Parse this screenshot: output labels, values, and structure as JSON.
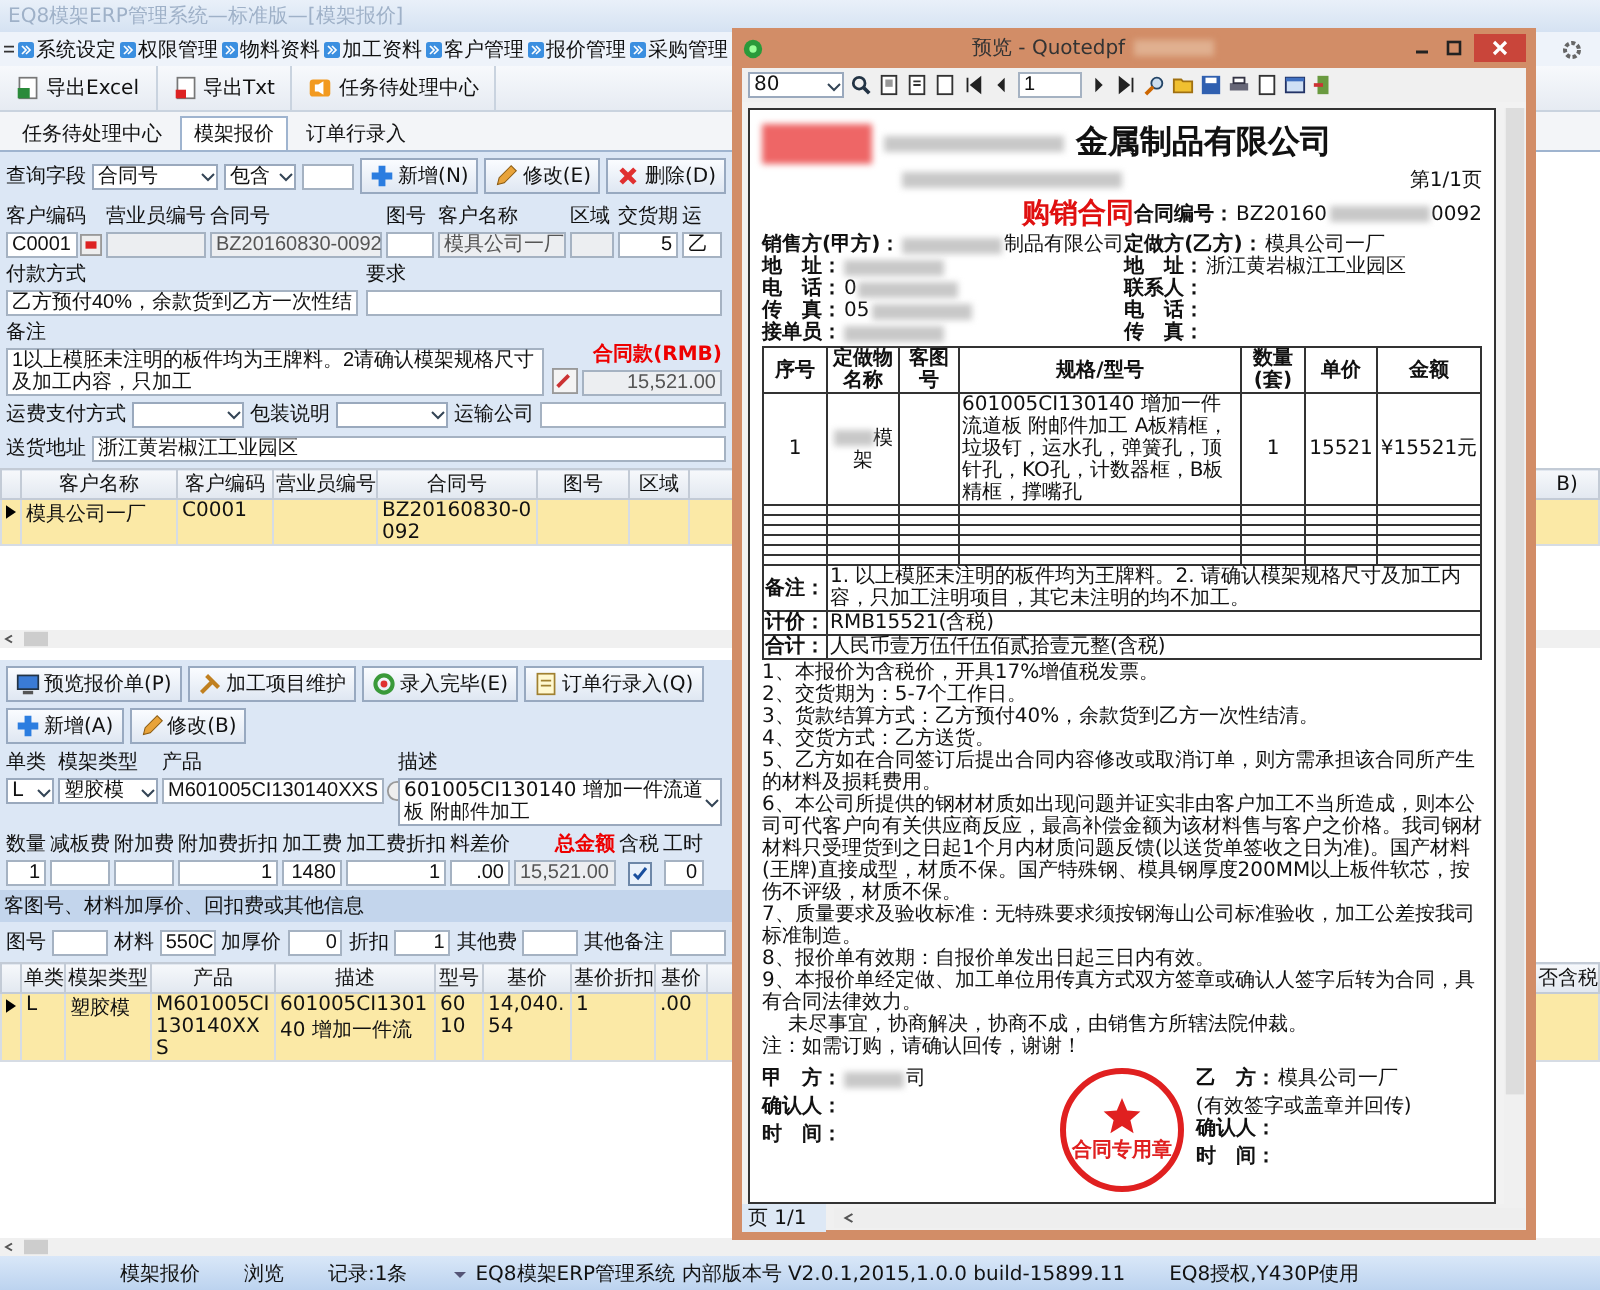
{
  "window": {
    "title": "EQ8模架ERP管理系统—标准版—[模架报价]"
  },
  "menu": [
    "系统设定",
    "权限管理",
    "物料资料",
    "加工资料",
    "客户管理",
    "报价管理",
    "采购管理"
  ],
  "toolbar": [
    {
      "label": "导出Excel",
      "kind": "excel"
    },
    {
      "label": "导出Txt",
      "kind": "txt"
    },
    {
      "label": "任务待处理中心",
      "kind": "speaker"
    }
  ],
  "tabs": [
    {
      "label": "任务待处理中心",
      "selected": false
    },
    {
      "label": "模架报价",
      "selected": true
    },
    {
      "label": "订单行录入",
      "selected": false
    }
  ],
  "query": {
    "label": "查询字段",
    "field": "合同号",
    "operator": "包含",
    "buttons": [
      {
        "label": "新增(N)",
        "kind": "add"
      },
      {
        "label": "修改(E)",
        "kind": "edit"
      },
      {
        "label": "删除(D)",
        "kind": "delete"
      }
    ]
  },
  "header_fields": [
    {
      "label": "客户编码",
      "value": "C0001",
      "kind": "lookup",
      "disabled": false
    },
    {
      "label": "营业员编号",
      "kind": "text",
      "disabled": true
    },
    {
      "label": "合同号",
      "value": "BZ20160830-0092",
      "kind": "text",
      "disabled": true
    },
    {
      "label": "图号",
      "kind": "text",
      "disabled": false
    },
    {
      "label": "客户名称",
      "value": "模具公司一厂",
      "kind": "text",
      "disabled": true
    },
    {
      "label": "区域",
      "kind": "text",
      "disabled": true
    },
    {
      "label": "交货期",
      "value": "5",
      "kind": "number",
      "disabled": false
    },
    {
      "label": "运",
      "value": "乙",
      "kind": "text",
      "disabled": false
    }
  ],
  "payment": {
    "label": "付款方式",
    "value": "乙方预付40%，余款货到乙方一次性结"
  },
  "requirement": {
    "label": "要求"
  },
  "remarks": {
    "label": "备注",
    "value": "1以上模胚未注明的板件均为王牌料。2请确认模架规格尺寸及加工内容，只加工"
  },
  "contract_amount": {
    "label": "合同款(RMB)",
    "value": "15,521.00"
  },
  "shipping": [
    {
      "label": "运费支付方式",
      "kind": "select"
    },
    {
      "label": "包装说明",
      "kind": "select"
    },
    {
      "label": "运输公司",
      "kind": "text"
    }
  ],
  "address": {
    "label": "送货地址",
    "value": "浙江黄岩椒江工业园区"
  },
  "contract_table": {
    "columns": [
      "客户名称",
      "客户编码",
      "营业员编号",
      "合同号",
      "图号",
      "区域",
      "B)"
    ],
    "rows": [
      {
        "selected": true,
        "cells": [
          "模具公司一厂",
          "C0001",
          "",
          "BZ20160830-0092",
          "",
          "",
          ""
        ]
      }
    ]
  },
  "line_buttons": [
    {
      "label": "预览报价单(P)",
      "kind": "preview"
    },
    {
      "label": "加工项目维护",
      "kind": "tools"
    },
    {
      "label": "录入完毕(E)",
      "kind": "done"
    },
    {
      "label": "订单行录入(Q)",
      "kind": "order"
    },
    {
      "label": "新增(A)",
      "kind": "add"
    },
    {
      "label": "修改(B)",
      "kind": "edit"
    }
  ],
  "line_fields": [
    {
      "label": "单类",
      "value": "L",
      "kind": "select"
    },
    {
      "label": "模架类型",
      "value": "塑胶模",
      "kind": "select"
    },
    {
      "label": "产品",
      "value": "M601005CI130140XXS",
      "kind": "lookup"
    },
    {
      "label": "描述",
      "value": "601005CI130140 增加一件流道板 附邮件加工",
      "kind": "select"
    }
  ],
  "amount_fields": [
    {
      "label": "数量",
      "value": "1",
      "kind": "number"
    },
    {
      "label": "减板费",
      "kind": "number"
    },
    {
      "label": "附加费",
      "kind": "number"
    },
    {
      "label": "附加费折扣",
      "value": "1",
      "kind": "number"
    },
    {
      "label": "加工费",
      "value": "1480",
      "kind": "number"
    },
    {
      "label": "加工费折扣",
      "value": "1",
      "kind": "number"
    },
    {
      "label": "料差价",
      "value": ".00",
      "kind": "number"
    },
    {
      "label": "总金额",
      "value": "15,521.00",
      "kind": "total"
    },
    {
      "label": "含税",
      "kind": "checkbox",
      "checked": true
    },
    {
      "label": "工时",
      "value": "0",
      "kind": "number"
    }
  ],
  "extra_section": {
    "title": "客图号、材料加厚价、回扣费或其他信息",
    "fields": [
      {
        "label": "图号"
      },
      {
        "label": "材料",
        "value": "550C"
      },
      {
        "label": "加厚价",
        "value": "0"
      },
      {
        "label": "折扣",
        "value": "1"
      },
      {
        "label": "其他费"
      },
      {
        "label": "其他备注"
      }
    ]
  },
  "line_table": {
    "columns": [
      "单类",
      "模架类型",
      "产品",
      "描述",
      "型号",
      "基价",
      "基价折扣",
      "基价",
      "否含税"
    ],
    "rows": [
      {
        "selected": true,
        "cells": [
          "L",
          "塑胶模",
          "M601005CI130140XXS",
          "601005CI130140 增加一件流",
          "6010",
          "14,040.54",
          "1",
          ".00",
          ""
        ]
      }
    ]
  },
  "status_bar": [
    "模架报价",
    "浏览",
    "记录:1条",
    "EQ8模架ERP管理系统 内部版本号 V2.0.1,2015,1.0.0 build-15899.11",
    "EQ8授权,Y430P使用"
  ],
  "preview": {
    "title": "预览 - Quotedpf",
    "zoom": "80",
    "page": "1",
    "page_status": "页 1/1",
    "document": {
      "company": "金属制品有限公司",
      "page_no": "第1/1页",
      "title": "购销合同",
      "contract_no": {
        "label": "合同编号：",
        "value": "BZ20160",
        "blurred": true,
        "suffix": "0092"
      },
      "seller": [
        {
          "label": "销售方(甲方)：",
          "blurred": true,
          "suffix": "制品有限公司"
        },
        {
          "label": "地　址：",
          "blurred": true
        },
        {
          "label": "电　话：",
          "value": "0",
          "blurred": true
        },
        {
          "label": "传　真：",
          "value": "05",
          "blurred": true
        },
        {
          "label": "接单员：",
          "blurred": true
        }
      ],
      "buyer": [
        {
          "label": "定做方(乙方)：",
          "value": "模具公司一厂",
          "blurred": false
        },
        {
          "label": "地　址：",
          "value": "浙江黄岩椒江工业园区",
          "blurred": false
        },
        {
          "label": "联系人：",
          "blurred": false
        },
        {
          "label": "电　话：",
          "blurred": false
        },
        {
          "label": "传　真：",
          "blurred": false
        }
      ],
      "items_table": {
        "columns": [
          "序号",
          "定做物名称",
          "客图号",
          "规格/型号",
          "数量(套)",
          "单价",
          "金额"
        ],
        "rows": [
          {
            "name_blurred": true,
            "cells": [
              "1",
              "模架",
              "",
              "601005CI130140 增加一件流道板 附邮件加工 A板精框，垃圾钉，运水孔，弹簧孔，顶针孔，KO孔，计数器框，B板精框，撑嘴孔",
              "1",
              "15521",
              "¥15521元"
            ]
          }
        ]
      },
      "remark": {
        "label": "备注：",
        "value": "1. 以上模胚未注明的板件均为王牌料。2. 请确认模架规格尺寸及加工内容，只加工注明项目，其它未注明的均不加工。"
      },
      "pricing": {
        "label": "计价：",
        "value": "RMB15521(含税)"
      },
      "total": {
        "label": "合计：",
        "value": "人民币壹万伍仟伍佰贰拾壹元整(含税)"
      },
      "terms": [
        "1、本报价为含税价，开具17%增值税发票。",
        "2、交货期为：5-7个工作日。",
        "3、货款结算方式：乙方预付40%，余款货到乙方一次性结清。",
        "4、交货方式：乙方送货。",
        "5、乙方如在合同签订后提出合同内容修改或取消订单，则方需承担该合同所产生的材料及损耗费用。",
        "6、本公司所提供的钢材材质如出现问题并证实非由客户加工不当所造成，则本公司可代客户向有关供应商反应，最高补偿金额为该材料售与客户之价格。我司钢材材料只受理货到之日起1个月内材质问题反馈(以送货单签收之日为准)。国产材料(王牌)直接成型，材质不保。国产特殊钢、模具钢厚度200MM以上板件软芯，按伤不评级，材质不保。",
        "7、质量要求及验收标准：无特殊要求须按钢海山公司标准验收，加工公差按我司标准制造。",
        "8、报价单有效期：自报价单发出日起三日内有效。",
        "9、本报价单经定做、加工单位用传真方式双方签章或确认人签字后转为合同，具有合同法律效力。",
        "　 未尽事宜，协商解决，协商不成，由销售方所辖法院仲裁。",
        "注：如需订购，请确认回传，谢谢！"
      ],
      "signatures": {
        "left": [
          {
            "label": "甲　方：",
            "blurred": true,
            "suffix": "司"
          },
          {
            "label": "确认人：",
            "blurred": false
          },
          {
            "label": "时　间：",
            "blurred": false
          }
        ],
        "right": [
          {
            "label": "乙　方：",
            "value": "模具公司一厂",
            "note": "(有效签字或盖章并回传)",
            "blurred": false
          },
          {
            "label": "确认人：",
            "blurred": false
          },
          {
            "label": "时　间：",
            "blurred": false
          }
        ]
      },
      "stamp": {
        "text": "合同专用章"
      }
    }
  }
}
